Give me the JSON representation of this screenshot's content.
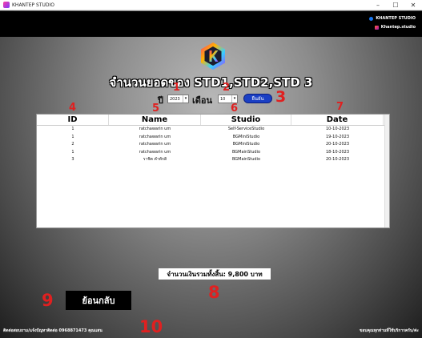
{
  "window": {
    "title": "KHANTEP STUDIO",
    "controls": [
      "–",
      "☐",
      "✕"
    ]
  },
  "social": {
    "facebook": "KHANTEP STUDIO",
    "instagram": "Khantep.studio"
  },
  "heading": "จำนวนยอดของ STD1,STD2,STD 3",
  "filters": {
    "year_label": "ปี",
    "year_value": "2023",
    "month_label": "เดือน",
    "month_value": "10",
    "confirm_label": "ยืนยัน"
  },
  "table": {
    "headers": [
      "ID",
      "Name",
      "Studio",
      "Date"
    ],
    "rows": [
      [
        "1",
        "ratchawarin um",
        "Self-ServiceStudio",
        "10-10-2023"
      ],
      [
        "1",
        "ratchawarin um",
        "BGMiniStudio",
        "19-10-2023"
      ],
      [
        "2",
        "ratchawarin um",
        "BGMiniStudio",
        "20-10-2023"
      ],
      [
        "1",
        "ratchawarin um",
        "BGMainStudio",
        "18-10-2023"
      ],
      [
        "3",
        "ราชิต คำทักดิ",
        "BGMainStudio",
        "20-10-2023"
      ]
    ]
  },
  "total_text": "จำนวนเงินรวมทั้งสิ้น: 9,800 บาท",
  "back_label": "ย้อนกลับ",
  "footer": {
    "left": "ติดต่อสอบถาม/แจ้งปัญหาติดต่อ 0968871473 คุณแสน",
    "right": "ขอบคุณทุกท่านที่ใช้บริการครับ/ค่ะ"
  },
  "annotations": [
    "1",
    "2",
    "3",
    "4",
    "5",
    "6",
    "7",
    "8",
    "9",
    "10"
  ],
  "colors": {
    "accent": "#1a3fc4",
    "annotation": "#e02020"
  }
}
